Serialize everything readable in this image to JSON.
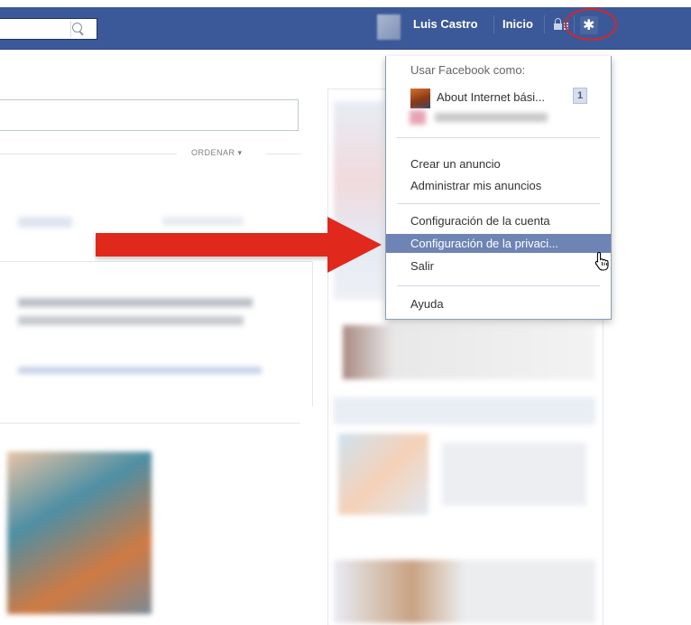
{
  "topbar": {
    "user_name": "Luis Castro",
    "home_label": "Inicio",
    "search_icon": "search-icon",
    "privacy_shortcuts_icon": "lock-list-icon",
    "account_icon": "gear-icon",
    "bar_color": "#3b5998"
  },
  "feed": {
    "sort_label": "ORDENAR ▾"
  },
  "menu": {
    "use_as_heading": "Usar Facebook como:",
    "page_name": "About Internet bási...",
    "page_badge": "1",
    "items": [
      {
        "label": "Crear un anuncio"
      },
      {
        "label": "Administrar mis anuncios"
      },
      {
        "label": "Configuración de la cuenta"
      },
      {
        "label": "Configuración de la privaci..."
      },
      {
        "label": "Salir"
      },
      {
        "label": "Ayuda"
      }
    ],
    "selected_color": "#6d84b4"
  },
  "annotation": {
    "arrow_color": "#e0281d",
    "ring_color": "#d6262b"
  }
}
